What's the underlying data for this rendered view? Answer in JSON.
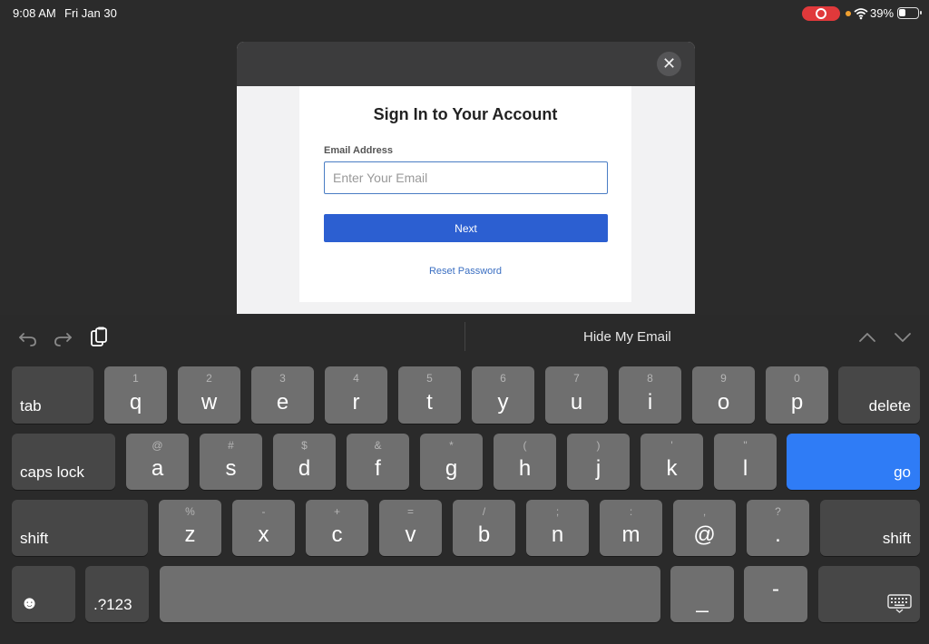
{
  "status": {
    "time": "9:08 AM",
    "date": "Fri Jan 30",
    "battery": "39%",
    "battery_level": 0.39
  },
  "modal": {
    "close_symbol": "✕",
    "title": "Sign In to Your Account",
    "email_label": "Email Address",
    "email_placeholder": "Enter Your Email",
    "email_value": "",
    "next_label": "Next",
    "reset_label": "Reset Password"
  },
  "toolbar": {
    "undo_icon": "undo-icon",
    "redo_icon": "redo-icon",
    "paste_icon": "paste-icon",
    "hide_my_email": "Hide My Email",
    "prev_icon": "chevron-up-icon",
    "next_icon": "chevron-down-icon"
  },
  "keyboard": {
    "row1": [
      {
        "alt": "1",
        "main": "q"
      },
      {
        "alt": "2",
        "main": "w"
      },
      {
        "alt": "3",
        "main": "e"
      },
      {
        "alt": "4",
        "main": "r"
      },
      {
        "alt": "5",
        "main": "t"
      },
      {
        "alt": "6",
        "main": "y"
      },
      {
        "alt": "7",
        "main": "u"
      },
      {
        "alt": "8",
        "main": "i"
      },
      {
        "alt": "9",
        "main": "o"
      },
      {
        "alt": "0",
        "main": "p"
      }
    ],
    "row2": [
      {
        "alt": "@",
        "main": "a"
      },
      {
        "alt": "#",
        "main": "s"
      },
      {
        "alt": "$",
        "main": "d"
      },
      {
        "alt": "&",
        "main": "f"
      },
      {
        "alt": "*",
        "main": "g"
      },
      {
        "alt": "(",
        "main": "h"
      },
      {
        "alt": ")",
        "main": "j"
      },
      {
        "alt": "'",
        "main": "k"
      },
      {
        "alt": "\"",
        "main": "l"
      }
    ],
    "row3": [
      {
        "alt": "%",
        "main": "z"
      },
      {
        "alt": "-",
        "main": "x"
      },
      {
        "alt": "+",
        "main": "c"
      },
      {
        "alt": "=",
        "main": "v"
      },
      {
        "alt": "/",
        "main": "b"
      },
      {
        "alt": ";",
        "main": "n"
      },
      {
        "alt": ":",
        "main": "m"
      },
      {
        "alt": ",",
        "main": "@"
      },
      {
        "alt": "?",
        "main": "."
      }
    ],
    "tab": "tab",
    "delete": "delete",
    "caps_lock": "caps lock",
    "go": "go",
    "shift": "shift",
    "emoji": "☻",
    "numbers": ".?123",
    "underscore": "_",
    "dash": "-",
    "keyboard_icon": "keyboard-icon"
  },
  "colors": {
    "accent": "#2f7cf6",
    "button": "#2c5fd1",
    "link": "#3b6fc2",
    "record": "#e0393b"
  }
}
